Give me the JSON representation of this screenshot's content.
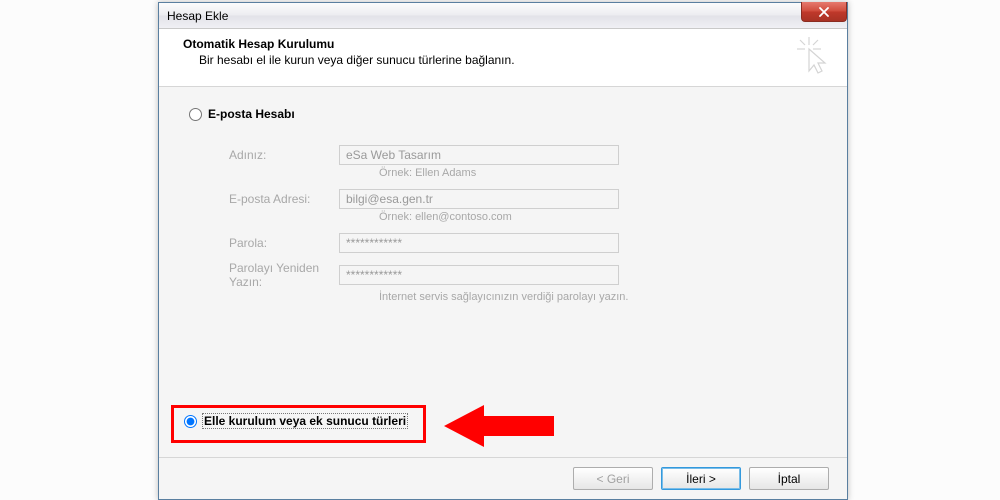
{
  "window": {
    "title": "Hesap Ekle"
  },
  "header": {
    "title": "Otomatik Hesap Kurulumu",
    "subtitle": "Bir hesabı el ile kurun veya diğer sunucu türlerine bağlanın."
  },
  "options": {
    "email_account": "E-posta Hesabı",
    "manual_setup": "Elle kurulum veya ek sunucu türleri"
  },
  "form": {
    "name_label": "Adınız:",
    "name_value": "eSa Web Tasarım",
    "name_hint": "Örnek: Ellen Adams",
    "email_label": "E-posta Adresi:",
    "email_value": "bilgi@esa.gen.tr",
    "email_hint": "Örnek: ellen@contoso.com",
    "password_label": "Parola:",
    "password_value": "************",
    "password2_label": "Parolayı Yeniden Yazın:",
    "password2_value": "************",
    "password_hint": "İnternet servis sağlayıcınızın verdiği parolayı yazın."
  },
  "buttons": {
    "back": "< Geri",
    "next": "İleri >",
    "cancel": "İptal"
  }
}
